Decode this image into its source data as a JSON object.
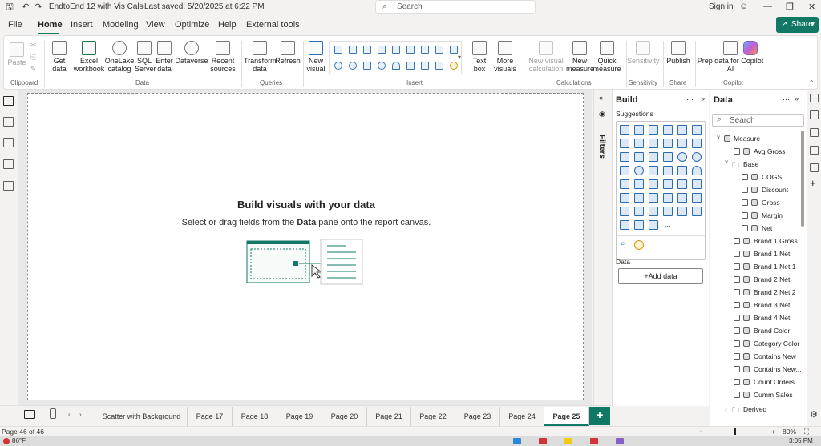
{
  "titlebar": {
    "doc_title": "EndtoEnd 12 with Vis Cals",
    "saved": "Last saved: 5/20/2025 at 6:22 PM",
    "search_placeholder": "Search",
    "signin": "Sign in",
    "separator": "·"
  },
  "menu": [
    "File",
    "Home",
    "Insert",
    "Modeling",
    "View",
    "Optimize",
    "Help",
    "External tools"
  ],
  "share_label": "Share",
  "ribbon": {
    "paste": "Paste",
    "get_data": "Get\ndata",
    "excel": "Excel\nworkbook",
    "onelake": "OneLake\ncatalog",
    "sql": "SQL\nServer",
    "enter_data": "Enter\ndata",
    "dataverse": "Dataverse",
    "recent": "Recent\nsources",
    "transform": "Transform\ndata",
    "refresh": "Refresh",
    "new_visual": "New\nvisual",
    "text_box": "Text\nbox",
    "more_visuals": "More\nvisuals",
    "new_visual_calc": "New visual\ncalculation",
    "new_measure": "New\nmeasure",
    "quick_measure": "Quick\nmeasure",
    "sensitivity": "Sensitivity",
    "publish": "Publish",
    "copilot_prep": "Prep data for Copilot\nAI",
    "copilot": "Copilot",
    "groups": {
      "clipboard": "Clipboard",
      "data": "Data",
      "queries": "Queries",
      "insert": "Insert",
      "calculations": "Calculations",
      "sensitivity": "Sensitivity",
      "share": "Share",
      "copilot": "Copilot"
    }
  },
  "canvas": {
    "heading": "Build visuals with your data",
    "sub_before": "Select or drag fields from the ",
    "sub_bold": "Data",
    "sub_after": " pane onto the report canvas."
  },
  "filters_label": "Filters",
  "build": {
    "title": "Build",
    "suggestions": "Suggestions",
    "data_label": "Data",
    "add_data": "+Add data",
    "more_dots": "···",
    "more_visuals_dots": "..."
  },
  "data_pane": {
    "title": "Data",
    "search_placeholder": "Search",
    "table": "Measure",
    "items_top": [
      "Avg Gross"
    ],
    "folder": "Base",
    "folder_items": [
      "COGS",
      "Discount",
      "Gross",
      "Margin",
      "Net"
    ],
    "items": [
      "Brand 1 Gross",
      "Brand 1 Net",
      "Brand 1 Net 1",
      "Brand 2 Net",
      "Brand 2 Net 2",
      "Brand 3 Net",
      "Brand 4 Net",
      "Brand Color",
      "Category Color",
      "Contains New",
      "Contains New...",
      "Count Orders",
      "Cumm Sales"
    ],
    "folder2": "Derived"
  },
  "tabs": [
    "Scatter with Background",
    "Page 17",
    "Page 18",
    "Page 19",
    "Page 20",
    "Page 21",
    "Page 22",
    "Page 23",
    "Page 24",
    "Page 25"
  ],
  "selected_tab": "Page 25",
  "add_tab": "+",
  "status": {
    "page": "Page 46 of 46",
    "zoom": "80%"
  },
  "taskbar": {
    "weather": "86°F",
    "time": "3:05 PM"
  }
}
